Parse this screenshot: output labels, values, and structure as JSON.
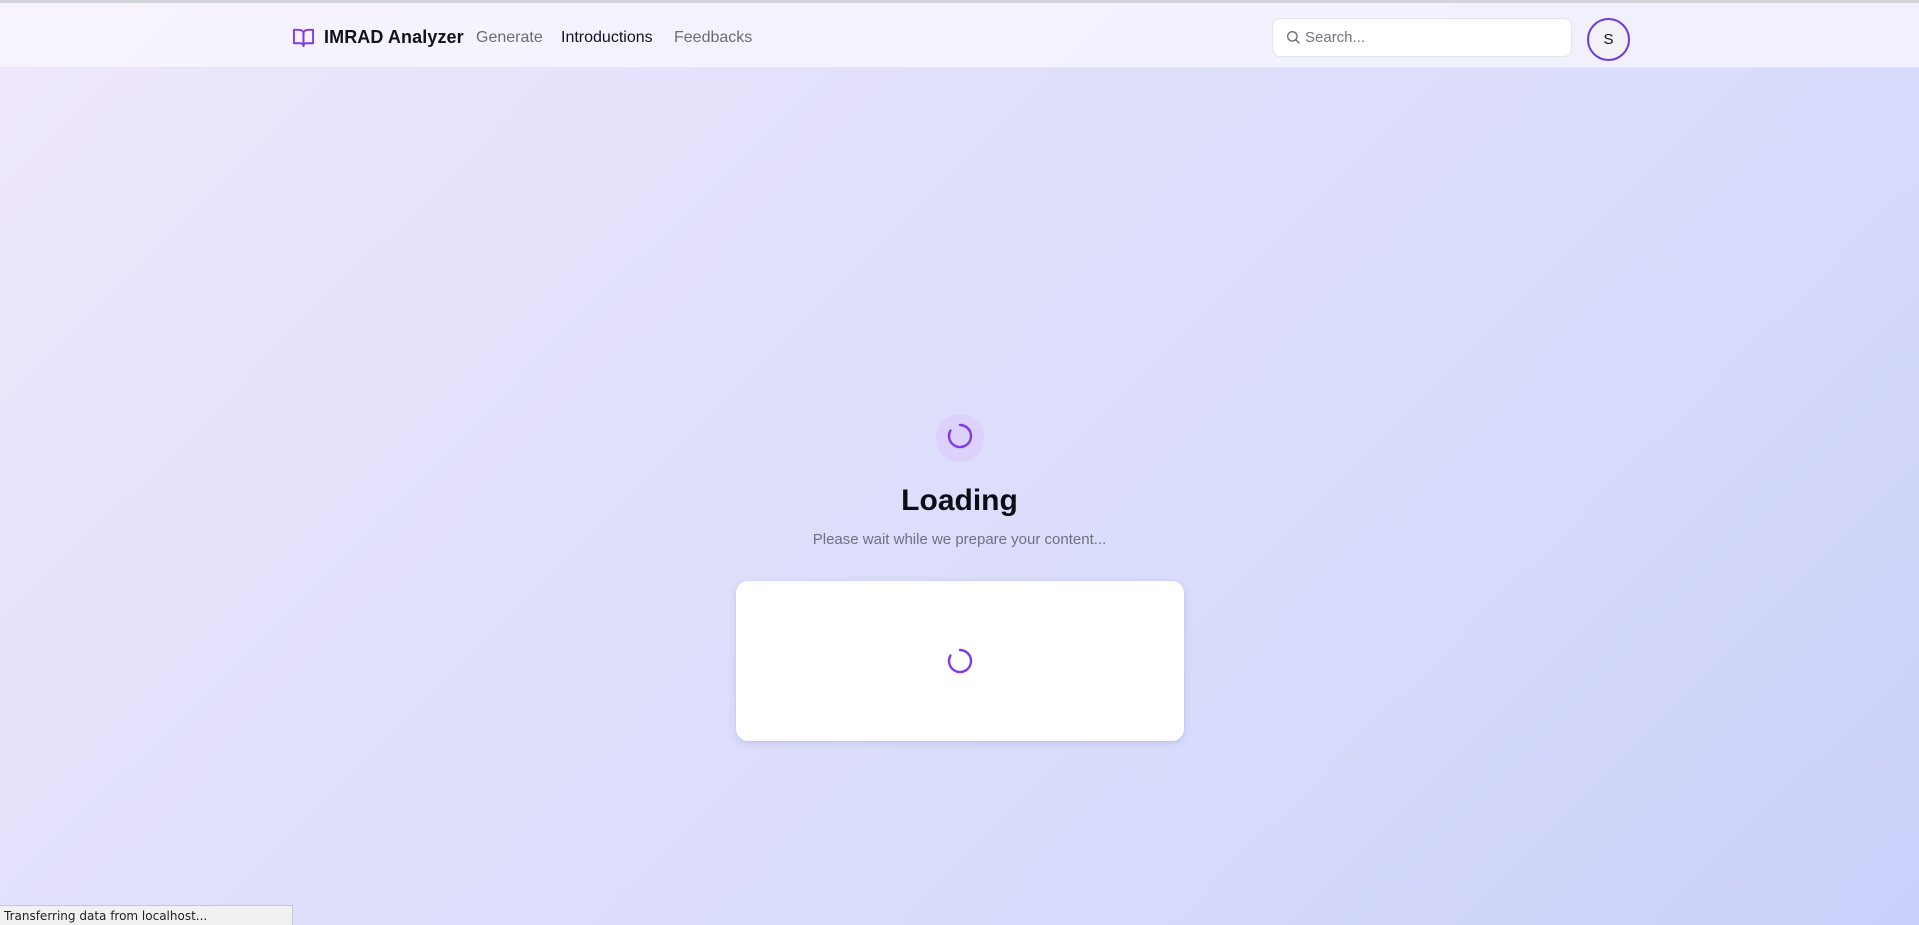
{
  "app": {
    "brand_name": "IMRAD Analyzer",
    "brand_icon": "book-open-icon"
  },
  "nav": {
    "links": [
      {
        "label": "Generate",
        "active": false
      },
      {
        "label": "Introductions",
        "active": true
      },
      {
        "label": "Feedbacks",
        "active": false
      }
    ]
  },
  "search": {
    "placeholder": "Search...",
    "value": "",
    "icon": "search-icon"
  },
  "user": {
    "avatar_initial": "S"
  },
  "loading": {
    "icon": "spinner-icon",
    "title": "Loading",
    "subtitle": "Please wait while we prepare your content..."
  },
  "browser_status": {
    "text": "Transferring data from localhost..."
  },
  "colors": {
    "accent": "#7c3aed",
    "avatar_border": "#6d3ae0",
    "background_start": "#f1e9fc",
    "background_end": "#c9d0fa"
  }
}
